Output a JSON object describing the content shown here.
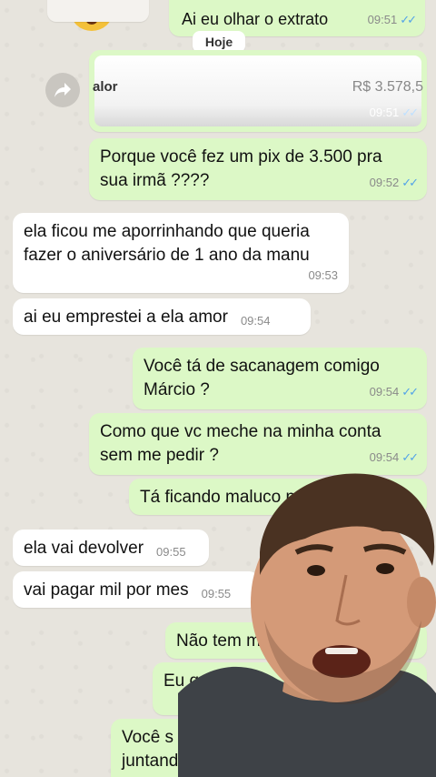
{
  "date_separator": "Hoje",
  "top_message": {
    "text": "Ai eu olhar o extrato",
    "time": "09:51"
  },
  "forwarded_card": {
    "label": "alor",
    "amount": "R$ 3.578,5",
    "time": "09:51"
  },
  "messages": [
    {
      "dir": "out",
      "lines": [
        "Porque você fez um pix de 3.500 pra",
        "sua irmã ????"
      ],
      "time": "09:52",
      "read": true
    },
    {
      "dir": "in",
      "lines": [
        "ela ficou me aporrinhando que queria",
        "fazer o aniversário de 1 ano da manu"
      ],
      "time": "09:53"
    },
    {
      "dir": "in",
      "lines": [
        "ai eu emprestei a ela amor"
      ],
      "time": "09:54"
    },
    {
      "dir": "out",
      "lines": [
        "Você tá de sacanagem comigo",
        "Márcio ?"
      ],
      "time": "09:54",
      "read": true
    },
    {
      "dir": "out",
      "lines": [
        "Como que vc meche na minha conta",
        "sem me pedir ?"
      ],
      "time": "09:54",
      "read": true
    },
    {
      "dir": "out",
      "lines": [
        "Tá ficando maluco p"
      ],
      "time": ""
    },
    {
      "dir": "in",
      "lines": [
        "ela vai devolver"
      ],
      "time": "09:55"
    },
    {
      "dir": "in",
      "lines": [
        "vai pagar mil por mes"
      ],
      "time": "09:55"
    },
    {
      "dir": "out",
      "lines": [
        "Não tem mil"
      ],
      "time": ""
    },
    {
      "dir": "out",
      "lines": [
        "Eu quero"
      ],
      "time": ""
    },
    {
      "dir": "out",
      "lines": [
        "Você s",
        "juntand"
      ],
      "time": ""
    }
  ],
  "colors": {
    "outgoing": "#dcf8c6",
    "incoming": "#ffffff",
    "read_ticks": "#53a3e8"
  }
}
